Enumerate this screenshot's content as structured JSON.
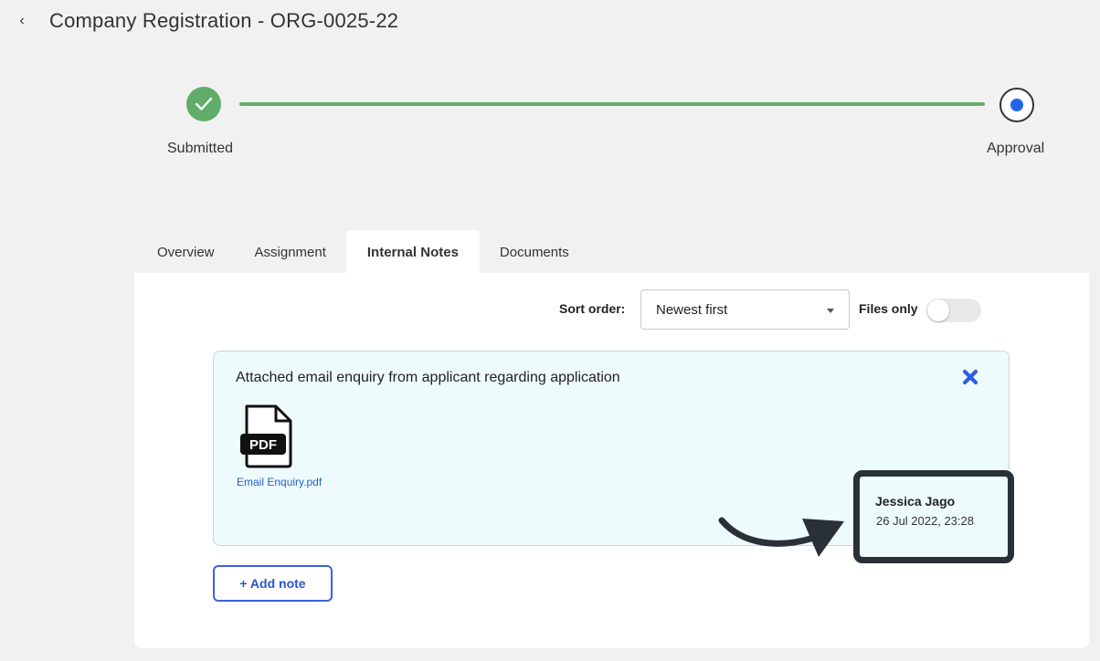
{
  "header": {
    "title": "Company Registration - ORG-0025-22"
  },
  "stepper": {
    "steps": [
      {
        "label": "Submitted",
        "status": "complete"
      },
      {
        "label": "Approval",
        "status": "current"
      }
    ],
    "complete_color": "#5fad68",
    "current_color": "#2563eb"
  },
  "tabs": [
    {
      "label": "Overview",
      "active": false
    },
    {
      "label": "Assignment",
      "active": false
    },
    {
      "label": "Internal Notes",
      "active": true
    },
    {
      "label": "Documents",
      "active": false
    }
  ],
  "controls": {
    "sort_label": "Sort order:",
    "sort_value": "Newest first",
    "files_only_label": "Files only",
    "files_only_on": false
  },
  "note": {
    "text": "Attached email enquiry from applicant regarding application",
    "attachment": {
      "icon": "pdf-file-icon",
      "badge": "PDF",
      "name": "Email Enquiry.pdf"
    },
    "author": "Jessica Jago",
    "timestamp": "26 Jul 2022, 23:28",
    "card_background": "#eefbfd"
  },
  "actions": {
    "add_note_label": "+ Add note"
  }
}
